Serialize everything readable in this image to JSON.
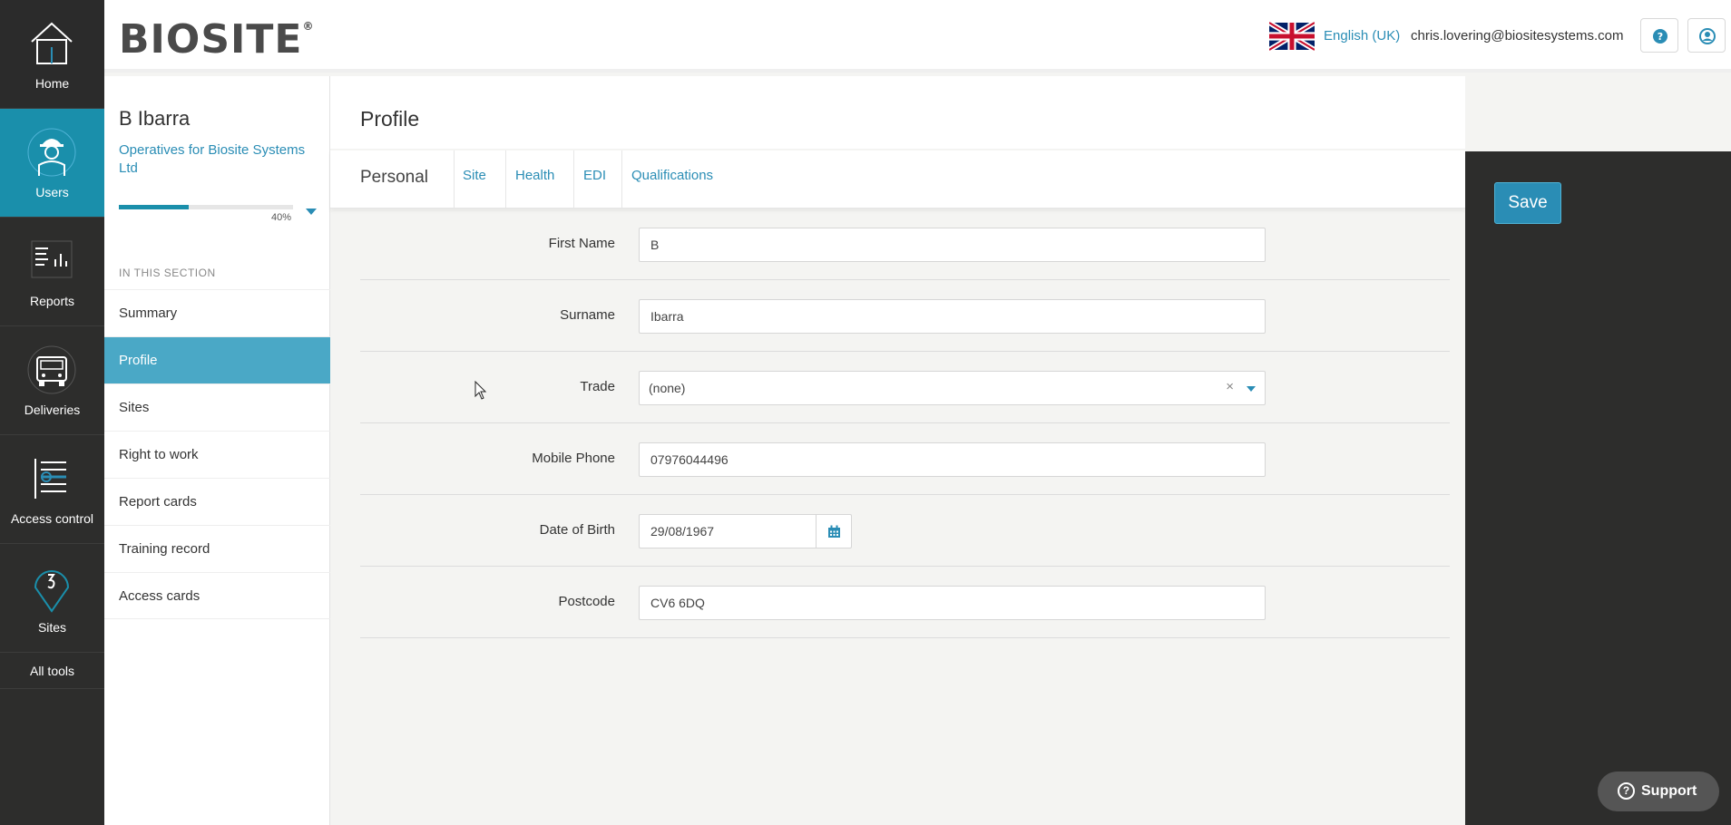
{
  "nav": {
    "items": [
      {
        "label": "Home",
        "icon": "home-icon"
      },
      {
        "label": "Users",
        "icon": "worker-icon"
      },
      {
        "label": "Reports",
        "icon": "reports-icon"
      },
      {
        "label": "Deliveries",
        "icon": "truck-icon"
      },
      {
        "label": "Access control",
        "icon": "access-control-icon"
      },
      {
        "label": "Sites",
        "icon": "map-pin-icon"
      }
    ],
    "all_tools": "All tools",
    "active": "Users",
    "active_color": "#1a8fab"
  },
  "header": {
    "logo": "BIOSITE",
    "logo_mark": "®",
    "language": "English (UK)",
    "email": "chris.lovering@biositesystems.com",
    "help_icon": "question-circle-icon",
    "account_icon": "user-circle-icon"
  },
  "section": {
    "person_name": "B Ibarra",
    "organisation": "Operatives for Biosite Systems Ltd",
    "progress_percent": 40,
    "progress_label": "40%",
    "heading": "IN THIS SECTION",
    "items": [
      {
        "label": "Summary",
        "active": false
      },
      {
        "label": "Profile",
        "active": true
      },
      {
        "label": "Sites",
        "active": false
      },
      {
        "label": "Right to work",
        "active": false
      },
      {
        "label": "Report cards",
        "active": false
      },
      {
        "label": "Training record",
        "active": false
      },
      {
        "label": "Access cards",
        "active": false
      }
    ]
  },
  "main": {
    "title": "Profile",
    "tabs": [
      {
        "label": "Personal",
        "active": true
      },
      {
        "label": "Site"
      },
      {
        "label": "Health"
      },
      {
        "label": "EDI"
      },
      {
        "label": "Qualifications"
      }
    ],
    "form": {
      "first_name": {
        "label": "First Name",
        "value": "B"
      },
      "surname": {
        "label": "Surname",
        "value": "Ibarra"
      },
      "trade": {
        "label": "Trade",
        "value": "(none)",
        "clear": "×"
      },
      "mobile_phone": {
        "label": "Mobile Phone",
        "value": "07976044496"
      },
      "date_of_birth": {
        "label": "Date of Birth",
        "value": "29/08/1967"
      },
      "postcode": {
        "label": "Postcode",
        "value": "CV6 6DQ"
      }
    }
  },
  "actions": {
    "save_label": "Save",
    "support_label": "Support",
    "support_glyph": "?"
  },
  "colors": {
    "accent": "#2a8db5",
    "rail": "#2d2d2c"
  }
}
